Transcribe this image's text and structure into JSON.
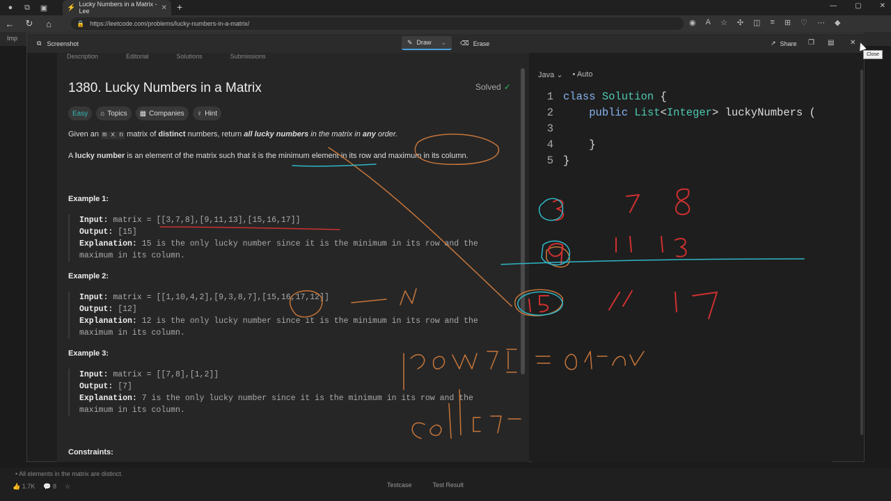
{
  "browser": {
    "tab_title": "Lucky Numbers in a Matrix - Lee",
    "url": "https://leetcode.com/problems/lucky-numbers-in-a-matrix/",
    "bookmark_text": "Imp"
  },
  "screenshot_tool": {
    "title": "Screenshot",
    "draw_label": "Draw",
    "erase_label": "Erase",
    "share_label": "Share",
    "close_tooltip": "Close"
  },
  "description": {
    "tabs": [
      "Description",
      "Editorial",
      "Solutions",
      "Submissions"
    ],
    "title": "1380. Lucky Numbers in a Matrix",
    "solved_label": "Solved",
    "chips": {
      "difficulty": "Easy",
      "topics": "Topics",
      "companies": "Companies",
      "hint": "Hint"
    },
    "para1": {
      "a": "Given an ",
      "code": "m x n",
      "b": " matrix of ",
      "c": "distinct",
      "d": " numbers, return ",
      "e": "all lucky numbers",
      "f": " in the matrix in ",
      "g": "any",
      "h": " order."
    },
    "para2": {
      "a": "A ",
      "b": "lucky number",
      "c": " is an element of the matrix such that it is the minimum element in its row and maximum in its column."
    },
    "examples": [
      {
        "heading": "Example 1:",
        "input_label": "Input:",
        "input": "matrix = [[3,7,8],[9,11,13],[15,16,17]]",
        "output_label": "Output:",
        "output": "[15]",
        "explanation_label": "Explanation:",
        "explanation1": "15 is the only lucky number since it is the minimum in its row and the",
        "explanation2": "maximum in its column."
      },
      {
        "heading": "Example 2:",
        "input_label": "Input:",
        "input": "matrix = [[1,10,4,2],[9,3,8,7],[15,16,17,12]]",
        "output_label": "Output:",
        "output": "[12]",
        "explanation_label": "Explanation:",
        "explanation1": "12 is the only lucky number since it is the minimum in its row and the",
        "explanation2": "maximum in its column."
      },
      {
        "heading": "Example 3:",
        "input_label": "Input:",
        "input": "matrix = [[7,8],[1,2]]",
        "output_label": "Output:",
        "output": "[7]",
        "explanation_label": "Explanation:",
        "explanation1": "7 is the only lucky number since it is the minimum in its row and the",
        "explanation2": "maximum in its column."
      }
    ],
    "constraints_label": "Constraints:"
  },
  "code": {
    "language": "Java",
    "mode": "Auto",
    "lines": [
      {
        "n": "1",
        "parts": [
          [
            "kw",
            "class "
          ],
          [
            "ty",
            "Solution"
          ],
          [
            "plain",
            " {"
          ]
        ]
      },
      {
        "n": "2",
        "parts": [
          [
            "plain",
            "    "
          ],
          [
            "kw",
            "public "
          ],
          [
            "ty",
            "List"
          ],
          [
            "plain",
            "<"
          ],
          [
            "ty",
            "Integer"
          ],
          [
            "plain",
            "> luckyNumbers ("
          ]
        ]
      },
      {
        "n": "3",
        "parts": [
          [
            "plain",
            ""
          ]
        ]
      },
      {
        "n": "4",
        "parts": [
          [
            "plain",
            "    }"
          ]
        ]
      },
      {
        "n": "5",
        "parts": [
          [
            "plain",
            "}"
          ]
        ]
      }
    ]
  },
  "background": {
    "constraint_text": "All elements in the matrix are distinct.",
    "likes": "1.7K",
    "comments": "8",
    "testcase_label": "Testcase",
    "test_result_label": "Test Result"
  },
  "colors": {
    "easy": "#2cbbb5",
    "solved_check": "#2cbb5d",
    "ink_orange": "#c8763a",
    "ink_red": "#d03030",
    "ink_cyan": "#2fb7c8"
  }
}
